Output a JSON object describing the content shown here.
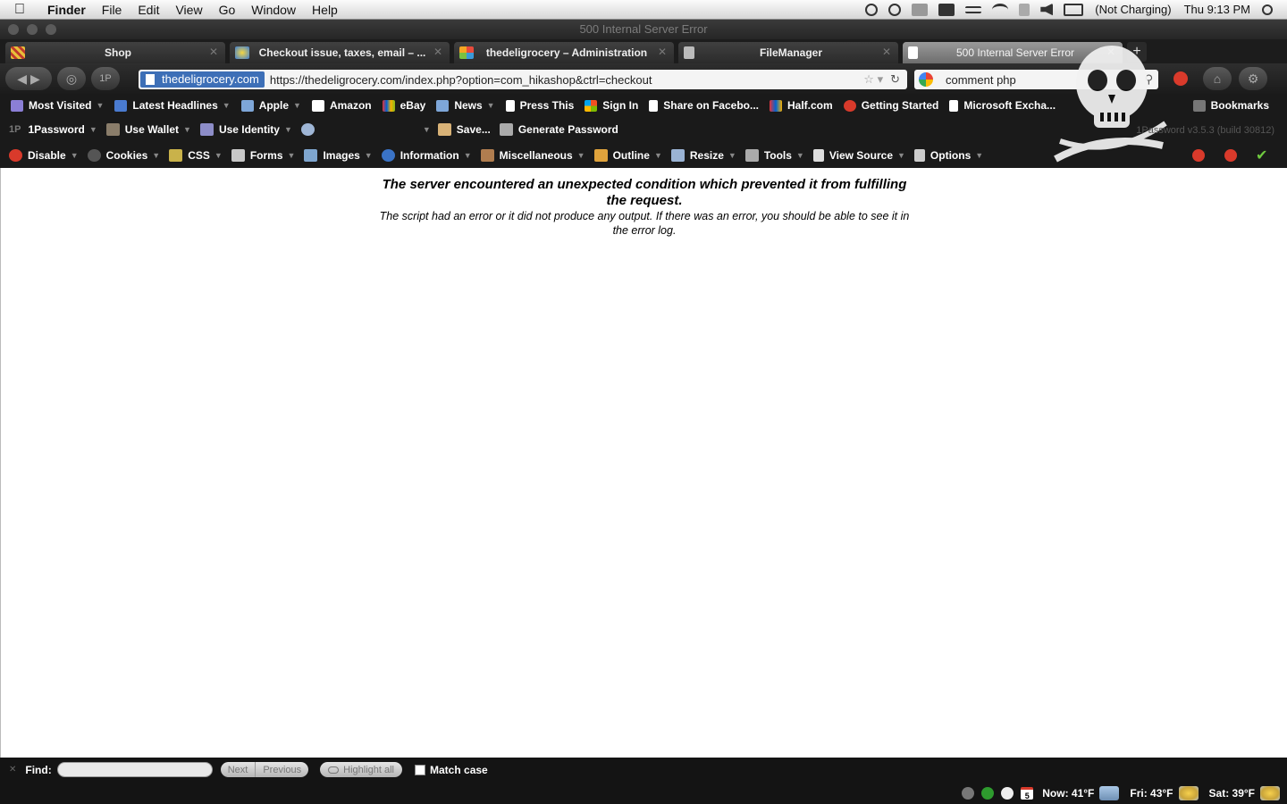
{
  "menubar": {
    "app": "Finder",
    "items": [
      "File",
      "Edit",
      "View",
      "Go",
      "Window",
      "Help"
    ],
    "power_status": "(Not Charging)",
    "clock": "Thu 9:13 PM"
  },
  "window": {
    "title": "500 Internal Server Error"
  },
  "tabs": [
    {
      "label": "Shop"
    },
    {
      "label": "Checkout issue, taxes, email – ..."
    },
    {
      "label": "thedeligrocery – Administration"
    },
    {
      "label": "FileManager"
    },
    {
      "label": "500 Internal Server Error"
    }
  ],
  "newtab_label": "+",
  "urlbar": {
    "site": "thedeligrocery.com",
    "url": "https://thedeligrocery.com/index.php?option=com_hikashop&ctrl=checkout"
  },
  "search": {
    "value": "comment php"
  },
  "bookmarks": [
    {
      "label": "Most Visited"
    },
    {
      "label": "Latest Headlines"
    },
    {
      "label": "Apple"
    },
    {
      "label": "Amazon"
    },
    {
      "label": "eBay"
    },
    {
      "label": "News"
    },
    {
      "label": "Press This"
    },
    {
      "label": "Sign In"
    },
    {
      "label": "Share on Facebo..."
    },
    {
      "label": "Half.com"
    },
    {
      "label": "Getting Started"
    },
    {
      "label": "Microsoft Excha..."
    },
    {
      "label": "Bookmarks"
    }
  ],
  "password_bar": {
    "onepassword": "1Password",
    "use_wallet": "Use Wallet",
    "use_identity": "Use Identity",
    "save": "Save...",
    "generate": "Generate Password",
    "version": "1Password v3.5.3 (build 30812)"
  },
  "webdev": [
    {
      "label": "Disable"
    },
    {
      "label": "Cookies"
    },
    {
      "label": "CSS"
    },
    {
      "label": "Forms"
    },
    {
      "label": "Images"
    },
    {
      "label": "Information"
    },
    {
      "label": "Miscellaneous"
    },
    {
      "label": "Outline"
    },
    {
      "label": "Resize"
    },
    {
      "label": "Tools"
    },
    {
      "label": "View Source"
    },
    {
      "label": "Options"
    }
  ],
  "page": {
    "heading": "The server encountered an unexpected condition which prevented it from fulfilling the request.",
    "body": "The script had an error or it did not produce any output. If there was an error, you should be able to see it in the error log."
  },
  "findbar": {
    "find_label": "Find:",
    "next": "Next",
    "previous": "Previous",
    "highlight": "Highlight all",
    "match_case": "Match case"
  },
  "status": {
    "now": "Now: 41°F",
    "fri": "Fri: 43°F",
    "sat": "Sat: 39°F",
    "calendar_day": "5"
  },
  "colors": {
    "accent": "#3d6fb7",
    "chrome_dark": "#1a1a1a",
    "error_red": "#d93a2b"
  }
}
